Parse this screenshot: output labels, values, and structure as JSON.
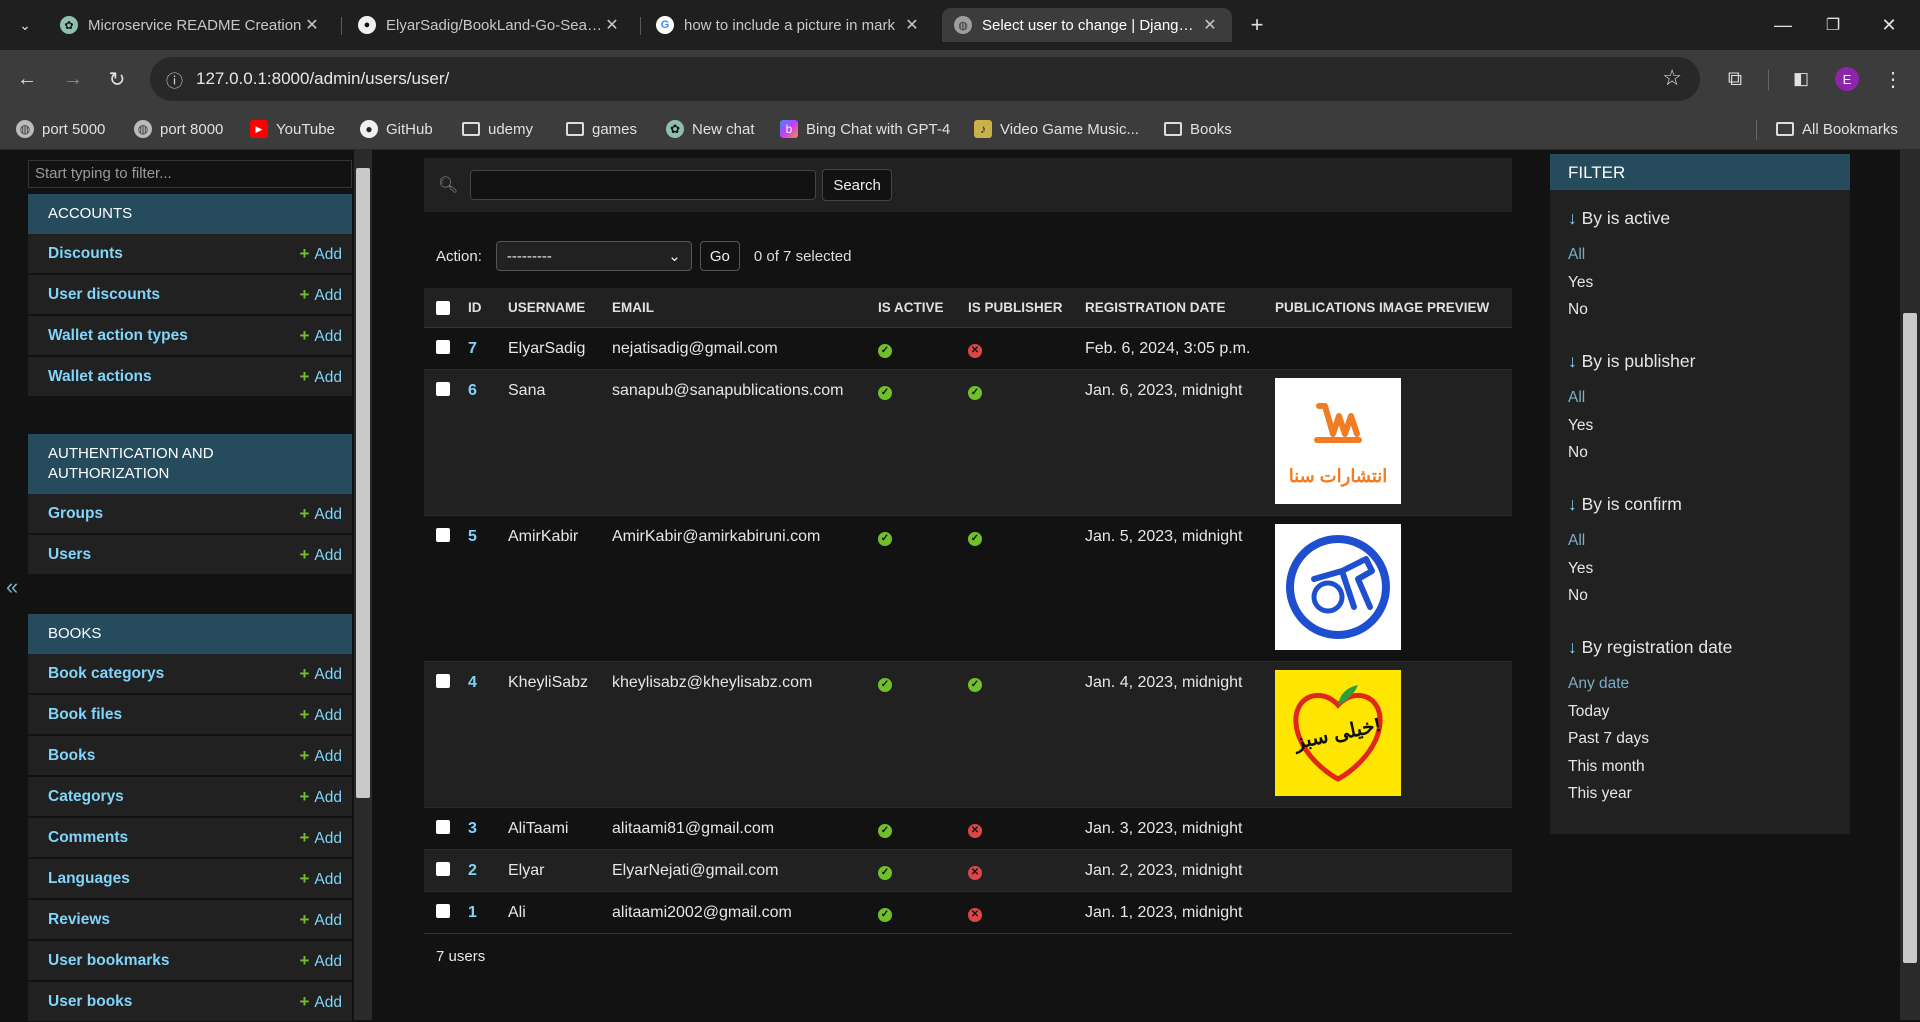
{
  "tabs": [
    {
      "title": "Microservice README Creation",
      "icon": "openai-icon"
    },
    {
      "title": "ElyarSadig/BookLand-Go-Search",
      "icon": "github-icon"
    },
    {
      "title": "how to include a picture in mark",
      "icon": "google-icon"
    },
    {
      "title": "Select user to change | Django site",
      "icon": "globe-icon"
    }
  ],
  "toolbar": {
    "url": "127.0.0.1:8000/admin/users/user/",
    "profile_initial": "E"
  },
  "bookmarks": [
    {
      "label": "port 5000",
      "icon": "globe-icon"
    },
    {
      "label": "port 8000",
      "icon": "globe-icon"
    },
    {
      "label": "YouTube",
      "icon": "youtube-icon"
    },
    {
      "label": "GitHub",
      "icon": "github-icon"
    },
    {
      "label": "udemy",
      "icon": "folder-icon"
    },
    {
      "label": "games",
      "icon": "folder-icon"
    },
    {
      "label": "New chat",
      "icon": "openai-icon"
    },
    {
      "label": "Bing Chat with GPT-4",
      "icon": "bing-icon"
    },
    {
      "label": "Video Game Music...",
      "icon": "music-icon"
    },
    {
      "label": "Books",
      "icon": "folder-icon"
    }
  ],
  "all_bookmarks": "All Bookmarks",
  "sidebar": {
    "filter_placeholder": "Start typing to filter...",
    "add_label": "Add",
    "collapse": "«",
    "modules": [
      {
        "name": "ACCOUNTS",
        "models": [
          "Discounts",
          "User discounts",
          "Wallet action types",
          "Wallet actions"
        ]
      },
      {
        "name": "AUTHENTICATION AND AUTHORIZATION",
        "models": [
          "Groups",
          "Users"
        ]
      },
      {
        "name": "BOOKS",
        "models": [
          "Book categorys",
          "Book files",
          "Books",
          "Categorys",
          "Comments",
          "Languages",
          "Reviews",
          "User bookmarks",
          "User books"
        ]
      }
    ]
  },
  "search": {
    "button": "Search"
  },
  "actions": {
    "label": "Action:",
    "selected": "---------",
    "go": "Go",
    "count": "0 of 7 selected"
  },
  "table": {
    "headers": [
      "ID",
      "USERNAME",
      "EMAIL",
      "IS ACTIVE",
      "IS PUBLISHER",
      "REGISTRATION DATE",
      "PUBLICATIONS IMAGE PREVIEW"
    ],
    "rows": [
      {
        "id": "7",
        "username": "ElyarSadig",
        "email": "nejatisadig@gmail.com",
        "active": true,
        "publisher": false,
        "date": "Feb. 6, 2024, 3:05 p.m.",
        "image": ""
      },
      {
        "id": "6",
        "username": "Sana",
        "email": "sanapub@sanapublications.com",
        "active": true,
        "publisher": true,
        "date": "Jan. 6, 2023, midnight",
        "image": "sana-logo"
      },
      {
        "id": "5",
        "username": "AmirKabir",
        "email": "AmirKabir@amirkabiruni.com",
        "active": true,
        "publisher": true,
        "date": "Jan. 5, 2023, midnight",
        "image": "amirkabir-logo"
      },
      {
        "id": "4",
        "username": "KheyliSabz",
        "email": "kheylisabz@kheylisabz.com",
        "active": true,
        "publisher": true,
        "date": "Jan. 4, 2023, midnight",
        "image": "kheylisabz-logo"
      },
      {
        "id": "3",
        "username": "AliTaami",
        "email": "alitaami81@gmail.com",
        "active": true,
        "publisher": false,
        "date": "Jan. 3, 2023, midnight",
        "image": ""
      },
      {
        "id": "2",
        "username": "Elyar",
        "email": "ElyarNejati@gmail.com",
        "active": true,
        "publisher": false,
        "date": "Jan. 2, 2023, midnight",
        "image": ""
      },
      {
        "id": "1",
        "username": "Ali",
        "email": "alitaami2002@gmail.com",
        "active": true,
        "publisher": false,
        "date": "Jan. 1, 2023, midnight",
        "image": ""
      }
    ],
    "logo_text": {
      "sana": "انتشارات سنا",
      "kheylisabz": "خیلی سبز!"
    },
    "result_count": "7 users"
  },
  "filter": {
    "title": "FILTER",
    "groups": [
      {
        "title": "By is active",
        "options": [
          "All",
          "Yes",
          "No"
        ]
      },
      {
        "title": "By is publisher",
        "options": [
          "All",
          "Yes",
          "No"
        ]
      },
      {
        "title": "By is confirm",
        "options": [
          "All",
          "Yes",
          "No"
        ]
      },
      {
        "title": "By registration date",
        "options": [
          "Any date",
          "Today",
          "Past 7 days",
          "This month",
          "This year"
        ]
      }
    ]
  },
  "colors": {
    "accent": "#81d4fa",
    "module_header": "#264b5d",
    "yes": "#70bf2b",
    "no": "#dd4646"
  }
}
